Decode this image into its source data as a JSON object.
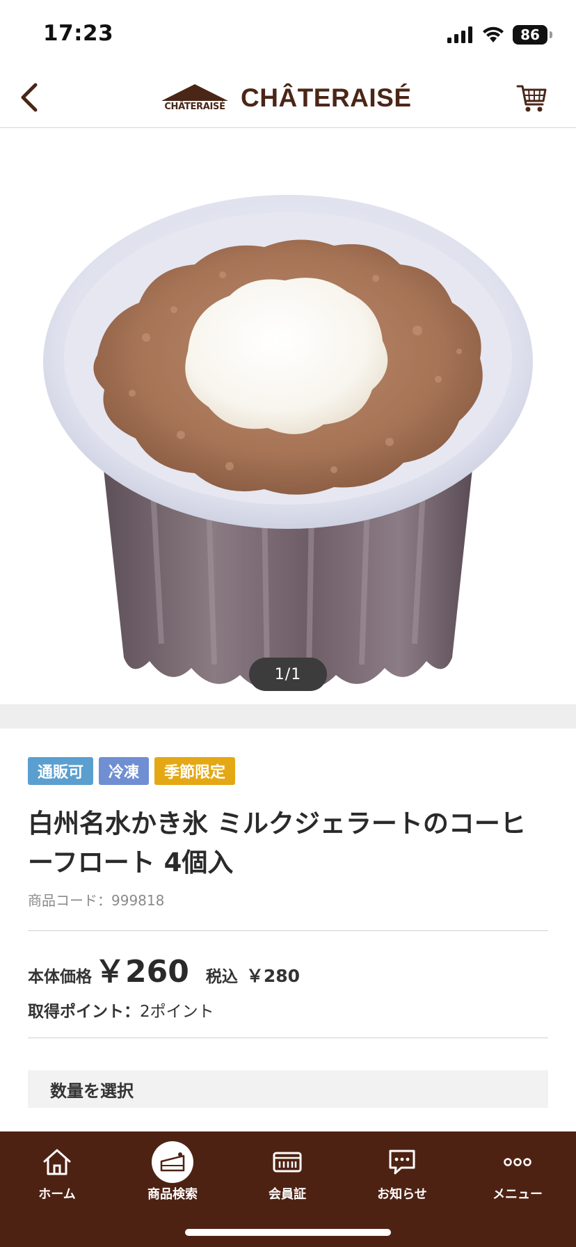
{
  "status_bar": {
    "time": "17:23",
    "battery": "86"
  },
  "header": {
    "logo_mark_text": "CHÂTERAISÉ",
    "logo_text": "CHÂTERAISÉ"
  },
  "gallery": {
    "counter": "1/1"
  },
  "product": {
    "tags": [
      "通販可",
      "冷凍",
      "季節限定"
    ],
    "title": "白州名水かき氷 ミルクジェラートのコーヒーフロート 4個入",
    "code": "商品コード：999818",
    "price_label": "本体価格",
    "price": "￥260",
    "tax_label": "税込",
    "tax_price": "￥280",
    "points_label": "取得ポイント：",
    "points_value": "2ポイント",
    "quantity_label": "数量を選択"
  },
  "nav": {
    "items": [
      {
        "label": "ホーム",
        "icon": "home-icon"
      },
      {
        "label": "商品検索",
        "icon": "cake-icon"
      },
      {
        "label": "会員証",
        "icon": "member-card-icon"
      },
      {
        "label": "お知らせ",
        "icon": "chat-icon"
      },
      {
        "label": "メニュー",
        "icon": "more-icon"
      }
    ]
  },
  "colors": {
    "brand_brown": "#4e2213",
    "tag_mail": "#5b9fd0",
    "tag_frozen": "#6f8fd2",
    "tag_season": "#e4a814"
  }
}
